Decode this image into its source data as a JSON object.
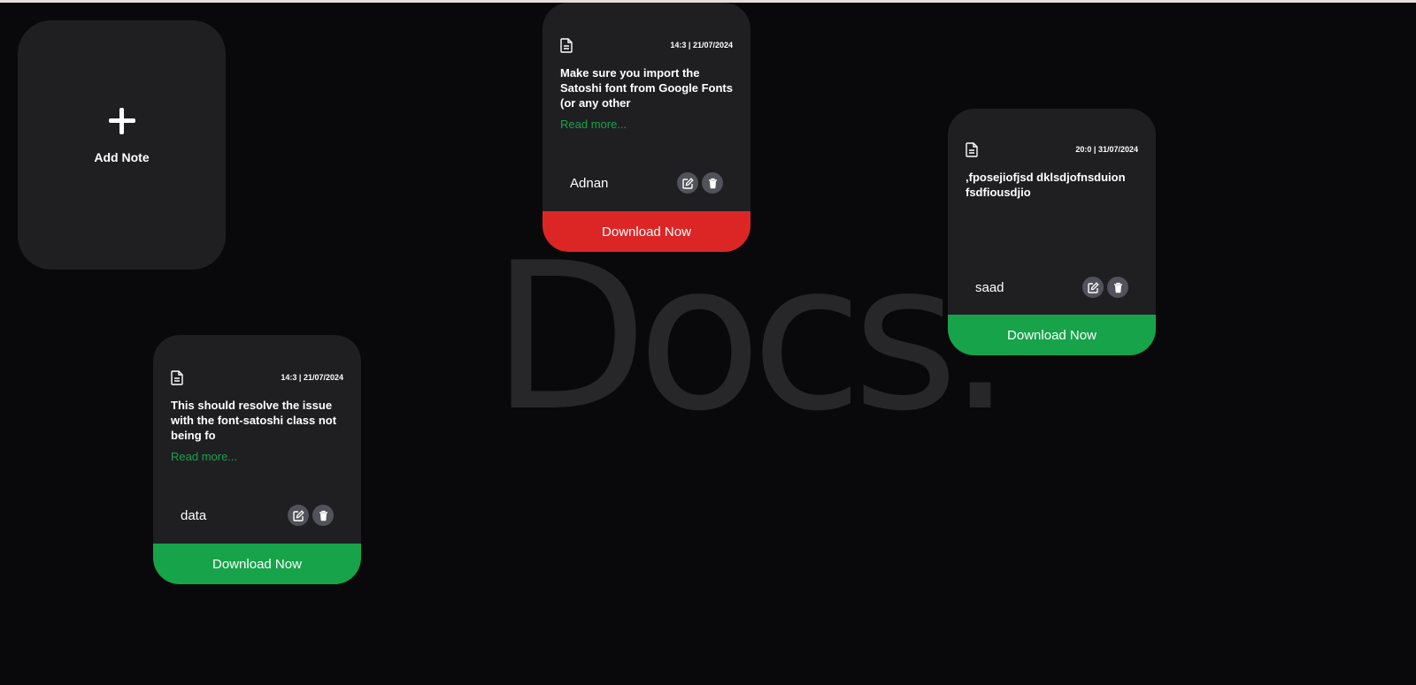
{
  "app": {
    "watermark": "Docs."
  },
  "add_note": {
    "label": "Add Note"
  },
  "colors": {
    "background": "#09090b",
    "card": "#1f1f22",
    "accent_green": "#16a34a",
    "accent_red": "#dc2626",
    "icon_button": "#52525b"
  },
  "notes": [
    {
      "date": "14:3 | 21/07/2024",
      "content": "Make sure you import the Satoshi font from Google Fonts (or any other",
      "read_more": "Read more...",
      "author": "Adnan",
      "download_label": "Download Now",
      "download_color": "#dc2626",
      "icons": [
        "document-icon",
        "edit-icon",
        "trash-icon"
      ]
    },
    {
      "date": "20:0 | 31/07/2024",
      "content": ",fposejiofjsd dklsdjofnsduion fsdfiousdjio",
      "read_more": "",
      "author": "saad",
      "download_label": "Download Now",
      "download_color": "#16a34a",
      "icons": [
        "document-icon",
        "edit-icon",
        "trash-icon"
      ]
    },
    {
      "date": "14:3 | 21/07/2024",
      "content": "This should resolve the issue with the font-satoshi class not being fo",
      "read_more": "Read more...",
      "author": "data",
      "download_label": "Download Now",
      "download_color": "#16a34a",
      "icons": [
        "document-icon",
        "edit-icon",
        "trash-icon"
      ]
    }
  ]
}
